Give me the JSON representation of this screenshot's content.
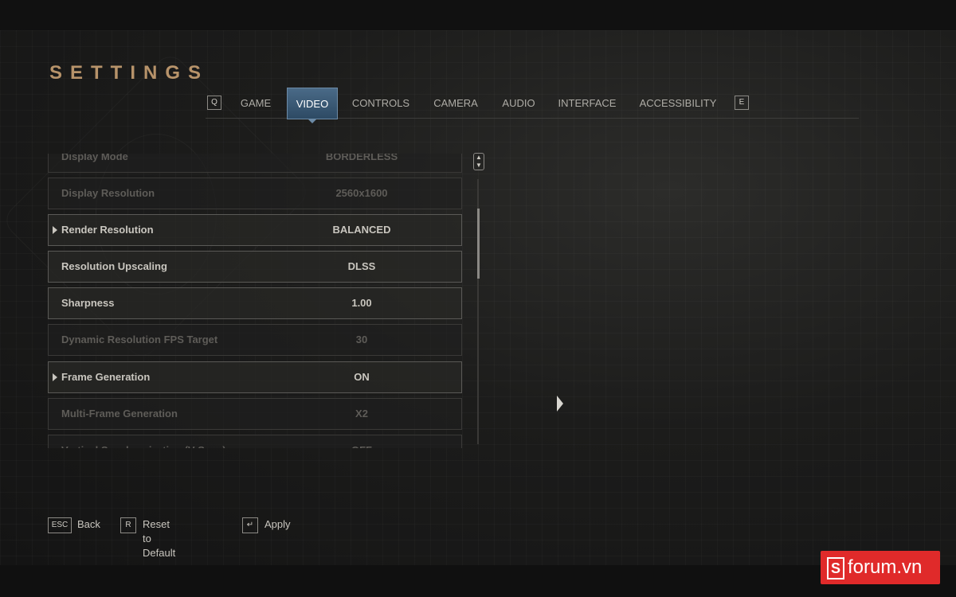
{
  "header": {
    "title": "SETTINGS"
  },
  "tabs": {
    "prev_key": "Q",
    "next_key": "E",
    "items": [
      {
        "label": "GAME"
      },
      {
        "label": "VIDEO",
        "active": true
      },
      {
        "label": "CONTROLS"
      },
      {
        "label": "CAMERA"
      },
      {
        "label": "AUDIO"
      },
      {
        "label": "INTERFACE"
      },
      {
        "label": "ACCESSIBILITY"
      }
    ]
  },
  "settings": {
    "rows": [
      {
        "label": "Display Mode",
        "value": "BORDERLESS",
        "state": "dim"
      },
      {
        "label": "Display Resolution",
        "value": "2560x1600",
        "state": "dim"
      },
      {
        "label": "Render Resolution",
        "value": "BALANCED",
        "state": "bright",
        "expandable": true
      },
      {
        "label": "Resolution Upscaling",
        "value": "DLSS",
        "state": "bright"
      },
      {
        "label": "Sharpness",
        "value": "1.00",
        "state": "bright"
      },
      {
        "label": "Dynamic Resolution FPS Target",
        "value": "30",
        "state": "dim"
      },
      {
        "label": "Frame Generation",
        "value": "ON",
        "state": "bright",
        "expandable": true
      },
      {
        "label": "Multi-Frame Generation",
        "value": "X2",
        "state": "dim"
      },
      {
        "label": "Vertical Synchronization (V-Sync)",
        "value": "OFF",
        "state": "dim"
      }
    ]
  },
  "footer": {
    "back_key": "ESC",
    "back_label": "Back",
    "reset_key": "R",
    "reset_label": "Reset to Default",
    "apply_key": "↵",
    "apply_label": "Apply"
  },
  "watermark": {
    "text": "forum.vn",
    "mark": "S"
  },
  "colors": {
    "accent": "#b7936a",
    "tab_active": "#3c5a76",
    "watermark": "#e02a2a"
  }
}
